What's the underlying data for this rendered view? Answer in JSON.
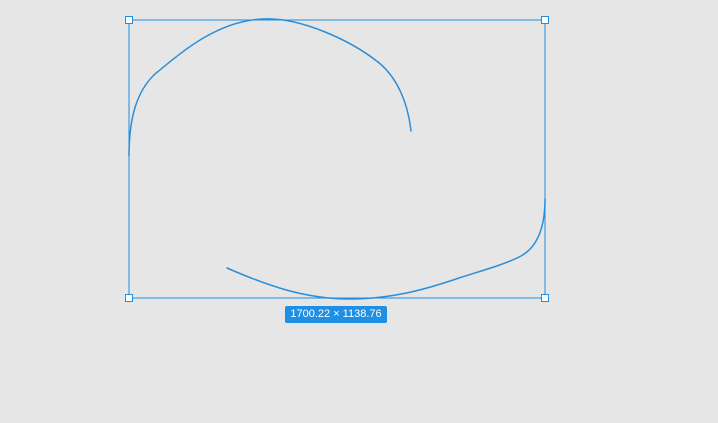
{
  "selection": {
    "dimensions_label": "1700.22 × 1138.76",
    "accent_color": "#1f8fe3",
    "handles": [
      "top-left-handle",
      "top-right-handle",
      "bottom-left-handle",
      "bottom-right-handle"
    ]
  },
  "canvas": {
    "background_color": "#e6e6e6"
  },
  "drawing": {
    "stroke_color": "#2a8ed8",
    "paths": [
      "upper-arc-stroke",
      "lower-arc-stroke"
    ]
  }
}
